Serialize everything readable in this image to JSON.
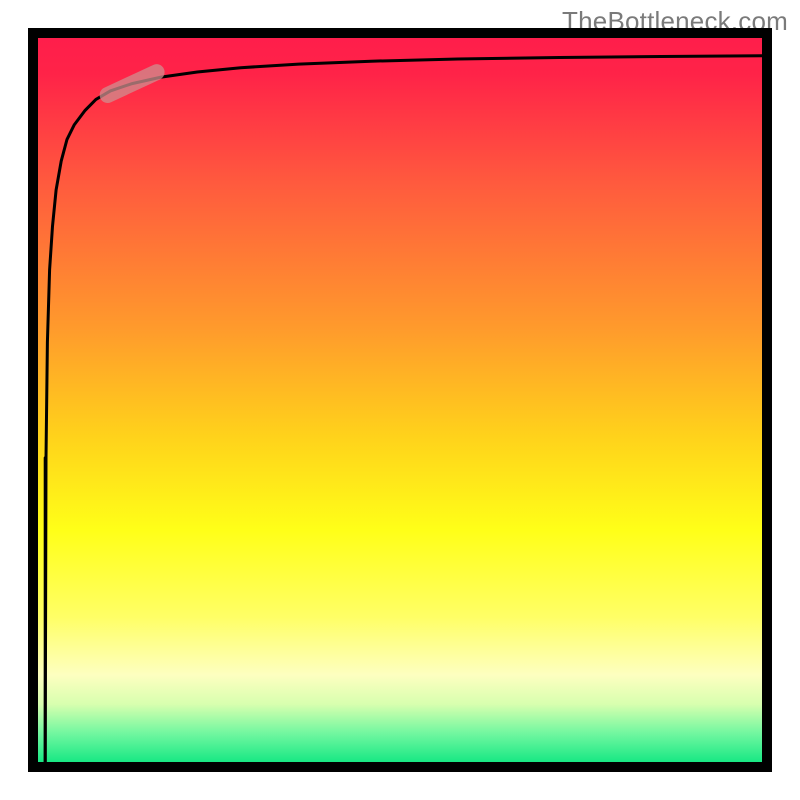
{
  "watermark": {
    "text": "TheBottleneck.com"
  },
  "chart_data": {
    "type": "line",
    "title": "",
    "xlabel": "",
    "ylabel": "",
    "xlim": [
      0,
      100
    ],
    "ylim": [
      0,
      100
    ],
    "gradient_stops": [
      {
        "pos": 0.0,
        "color": "#ff1e4b"
      },
      {
        "pos": 0.05,
        "color": "#ff2348"
      },
      {
        "pos": 0.2,
        "color": "#ff5a3e"
      },
      {
        "pos": 0.4,
        "color": "#ff9a2c"
      },
      {
        "pos": 0.55,
        "color": "#ffd21b"
      },
      {
        "pos": 0.68,
        "color": "#ffff18"
      },
      {
        "pos": 0.8,
        "color": "#ffff66"
      },
      {
        "pos": 0.88,
        "color": "#fdffc0"
      },
      {
        "pos": 0.92,
        "color": "#d8ffaf"
      },
      {
        "pos": 0.96,
        "color": "#72f7a0"
      },
      {
        "pos": 1.0,
        "color": "#18e884"
      }
    ],
    "series": [
      {
        "name": "curve",
        "x": [
          1.0,
          1.1,
          1.3,
          1.6,
          2.0,
          2.5,
          3.2,
          4.0,
          5.0,
          6.5,
          8.0,
          10,
          13,
          17,
          22,
          28,
          36,
          46,
          58,
          72,
          86,
          100
        ],
        "y": [
          0,
          42,
          58,
          68,
          74,
          79,
          83,
          86,
          88,
          90,
          91.5,
          92.7,
          93.7,
          94.6,
          95.3,
          95.9,
          96.4,
          96.8,
          97.1,
          97.3,
          97.45,
          97.55
        ]
      },
      {
        "name": "vertical-stem",
        "x": [
          1.0,
          1.0
        ],
        "y": [
          0,
          42
        ]
      }
    ],
    "marker": {
      "x": 13,
      "y": 93.7,
      "angle_deg": -25,
      "length": 70,
      "thickness": 16
    }
  }
}
